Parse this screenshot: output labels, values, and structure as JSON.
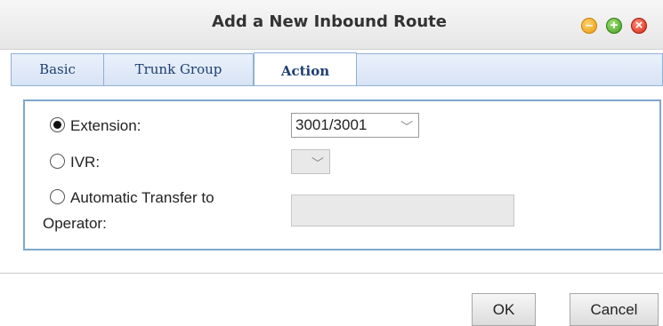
{
  "dialog": {
    "title": "Add a New Inbound Route",
    "window_buttons": {
      "minimize_icon": "minimize-circle-icon",
      "maximize_icon": "maximize-circle-icon",
      "close_icon": "close-circle-icon",
      "minimize_color": "#e89a10",
      "maximize_color": "#3d9a1b",
      "close_color": "#d32a13"
    }
  },
  "tabs": [
    {
      "label": "Basic",
      "active": false
    },
    {
      "label": "Trunk Group",
      "active": false
    },
    {
      "label": "Action",
      "active": true
    }
  ],
  "action": {
    "extension": {
      "label": "Extension:",
      "selected": true,
      "value": "3001/3001"
    },
    "ivr": {
      "label": "IVR:",
      "selected": false,
      "value": ""
    },
    "auto_transfer": {
      "label_line1": "Automatic Transfer to",
      "label_line2": "Operator:",
      "selected": false,
      "value": ""
    }
  },
  "buttons": {
    "ok": "OK",
    "cancel": "Cancel"
  }
}
